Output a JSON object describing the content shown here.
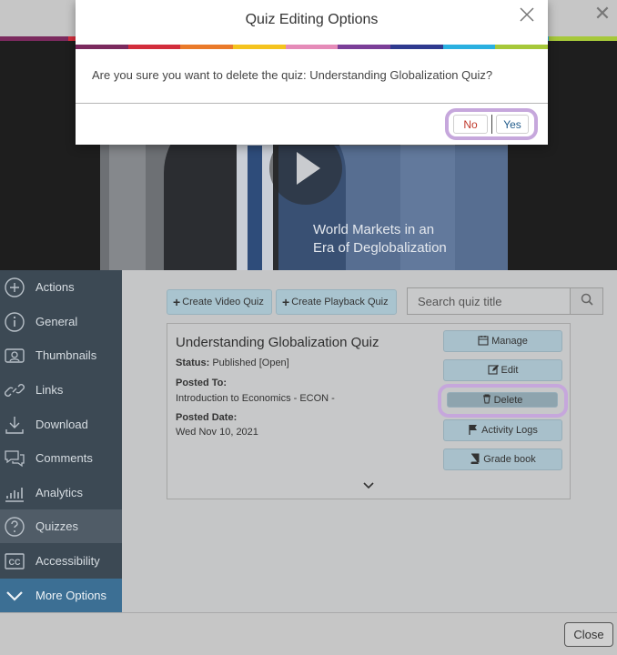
{
  "modal": {
    "title": "Quiz Editing Options",
    "message": "Are you sure you want to delete the quiz: Understanding Globalization Quiz?",
    "no_label": "No",
    "yes_label": "Yes"
  },
  "rainbow_colors": [
    "#7b2a5e",
    "#d22d3c",
    "#ea7a2a",
    "#f4c31e",
    "#e58bb8",
    "#7b3f98",
    "#2f3a8f",
    "#2ab0e0",
    "#a6c83a"
  ],
  "video": {
    "caption": "World Markets in an\nEra of Deglobalization"
  },
  "sidebar": {
    "items": [
      {
        "label": "Actions",
        "icon": "plus-circle-icon"
      },
      {
        "label": "General",
        "icon": "info-circle-icon"
      },
      {
        "label": "Thumbnails",
        "icon": "thumbnails-icon"
      },
      {
        "label": "Links",
        "icon": "link-icon"
      },
      {
        "label": "Download",
        "icon": "download-icon"
      },
      {
        "label": "Comments",
        "icon": "comments-icon"
      },
      {
        "label": "Analytics",
        "icon": "analytics-icon"
      },
      {
        "label": "Quizzes",
        "icon": "question-circle-icon"
      },
      {
        "label": "Accessibility",
        "icon": "cc-icon"
      },
      {
        "label": "More Options",
        "icon": "chevron-down-icon"
      }
    ]
  },
  "toolbar": {
    "create_video_quiz": "Create Video Quiz",
    "create_playback_quiz": "Create Playback Quiz",
    "search_placeholder": "Search quiz title"
  },
  "quiz": {
    "title": "Understanding Globalization Quiz",
    "status_label": "Status:",
    "status_value": "Published [Open]",
    "posted_to_label": "Posted To:",
    "posted_to_value": "Introduction to Economics - ECON -",
    "posted_date_label": "Posted Date:",
    "posted_date_value": "Wed Nov 10, 2021",
    "actions": {
      "manage": "Manage",
      "edit": "Edit",
      "delete": "Delete",
      "activity_logs": "Activity Logs",
      "grade_book": "Grade book"
    }
  },
  "footer": {
    "close_label": "Close"
  }
}
